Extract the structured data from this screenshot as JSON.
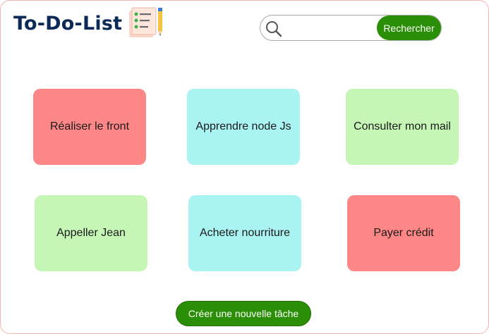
{
  "header": {
    "title": "To-Do-List",
    "logo_icon": "checklist-notepad-with-pencil-icon"
  },
  "search": {
    "placeholder": "",
    "value": "",
    "icon": "magnifier-icon",
    "button_label": "Rechercher"
  },
  "tasks": [
    {
      "label": "Réaliser le front",
      "color": "#fd8686"
    },
    {
      "label": "Apprendre node Js",
      "color": "#a9f3f3"
    },
    {
      "label": "Consulter mon mail",
      "color": "#c6f6b6"
    },
    {
      "label": "Appeller Jean",
      "color": "#c6f6b6"
    },
    {
      "label": "Acheter nourriture",
      "color": "#a9f3f3"
    },
    {
      "label": "Payer crédit",
      "color": "#fd8686"
    }
  ],
  "footer": {
    "create_label": "Créer une nouvelle tâche"
  },
  "colors": {
    "accent_green": "#2a8f06",
    "title_navy": "#0b2a57",
    "task_red": "#fd8686",
    "task_cyan": "#a9f3f3",
    "task_green": "#c6f6b6"
  }
}
